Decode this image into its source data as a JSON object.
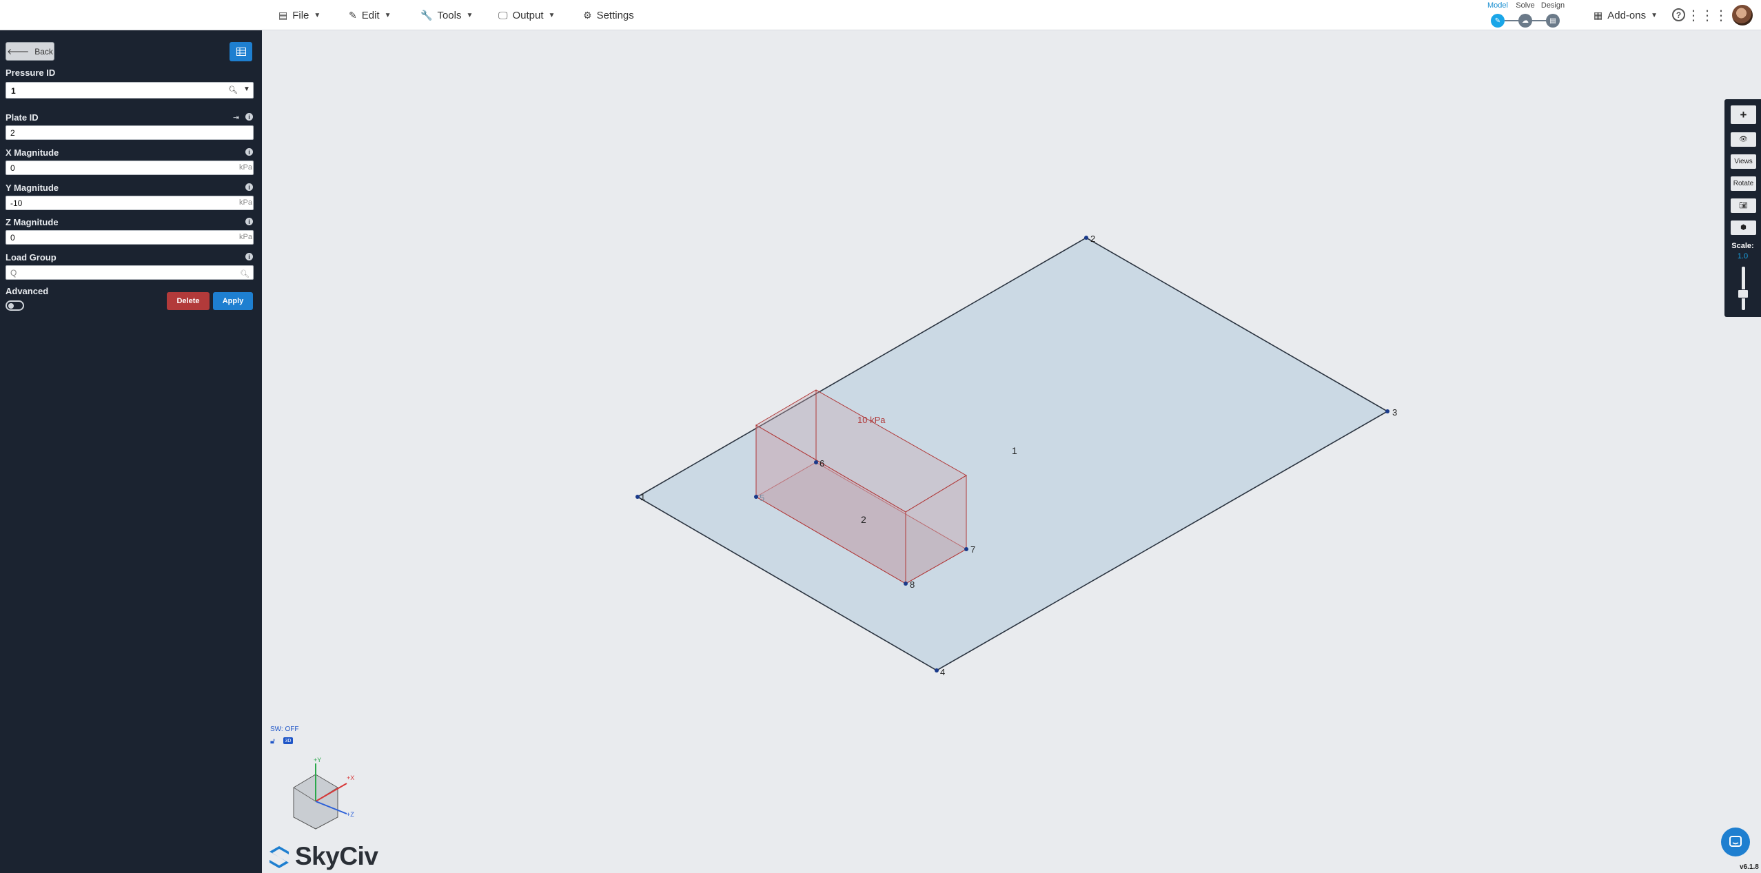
{
  "topbar": {
    "menu": {
      "file": "File",
      "edit": "Edit",
      "tools": "Tools",
      "output": "Output",
      "settings": "Settings"
    },
    "workflow": {
      "model": "Model",
      "solve": "Solve",
      "design": "Design"
    },
    "addons": "Add-ons"
  },
  "panel": {
    "back": "Back",
    "pressure_id": {
      "label": "Pressure ID",
      "value": "1"
    },
    "plate_id": {
      "label": "Plate ID",
      "value": "2"
    },
    "x_magnitude": {
      "label": "X Magnitude",
      "value": "0",
      "unit": "kPa"
    },
    "y_magnitude": {
      "label": "Y Magnitude",
      "value": "-10",
      "unit": "kPa"
    },
    "z_magnitude": {
      "label": "Z Magnitude",
      "value": "0",
      "unit": "kPa"
    },
    "load_group": {
      "label": "Load Group",
      "value": "Q"
    },
    "advanced": "Advanced",
    "delete": "Delete",
    "apply": "Apply"
  },
  "model_view": {
    "nodes": [
      "1",
      "2",
      "3",
      "4",
      "5",
      "6",
      "7",
      "8"
    ],
    "plates": [
      "1",
      "2"
    ],
    "pressure_label": "10 kPa"
  },
  "right_toolbar": {
    "views": "Views",
    "rotate": "Rotate",
    "scale_label": "Scale:",
    "scale_value": "1.0"
  },
  "status": {
    "self_weight": "SW: OFF",
    "axes": {
      "y": "+Y",
      "x": "+X",
      "z": "+Z"
    }
  },
  "brand": {
    "name": "SkyCiv",
    "version": "v6.1.8"
  },
  "colors": {
    "panel_bg": "#1b2330",
    "accent": "#1e7fd0",
    "delete": "#b23a3a",
    "plate_fill": "#cbd9e4",
    "pressure": "#b03838"
  }
}
